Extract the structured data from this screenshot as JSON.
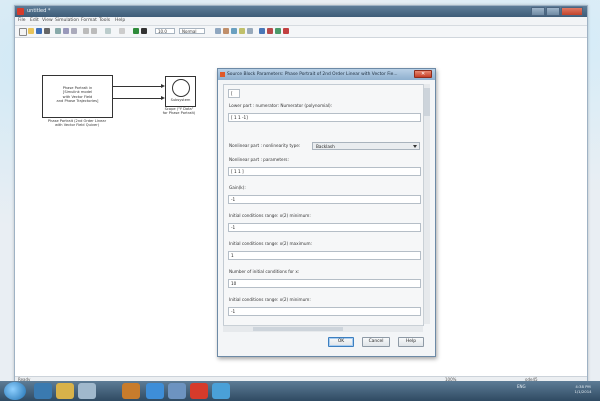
{
  "window": {
    "title": "untitled *",
    "menu": [
      "File",
      "Edit",
      "View",
      "Simulation",
      "Format",
      "Tools",
      "Help"
    ],
    "toolbar": {
      "stop_time": "10.0",
      "mode": "Normal"
    },
    "status": {
      "left": "Ready",
      "mid": "100%",
      "right": "ode45"
    }
  },
  "model": {
    "block1": {
      "lines": [
        "Phase Portrait in",
        "[Simulink model",
        "with Vector Field",
        "and Phase Trajectories]"
      ]
    },
    "block1_label": [
      "Phase Portrait (2nd Order Linear",
      "with Vector Field Quiver)"
    ],
    "block2": {
      "label": "Subsystem"
    },
    "block2_label": [
      "Scope (\"Y Data\"",
      "for Phase Portrait)"
    ]
  },
  "dialog": {
    "title": "Source Block Parameters: Phase Portrait of 2nd Order Linear with Vector Fie...",
    "params": [
      {
        "label": "",
        "value": "["
      },
      {
        "label": "Lower part : numerator: Numerator (polynomial):",
        "value": "[ 1 1 -1]"
      },
      {
        "label": "Nonlinear part : nonlinearity type:",
        "value": ""
      },
      {
        "label": "Nonlinear part : parameters:",
        "value": "[ 1 1 ]"
      },
      {
        "label": "Gain(k):",
        "value": "-1"
      },
      {
        "label": "Initial conditions range: x(2) minimum:",
        "value": "-1"
      },
      {
        "label": "Initial conditions range: x(2) maximum:",
        "value": "1"
      },
      {
        "label": "Number of initial conditions for x:",
        "value": "10"
      },
      {
        "label": "Initial conditions range: x(2) minimum:",
        "value": "-1"
      }
    ],
    "select": {
      "value": "Backlash"
    },
    "buttons": {
      "ok": "OK",
      "cancel": "Cancel",
      "help": "Help"
    }
  },
  "taskbar": {
    "tray": "ENG",
    "time": "4:38 PM",
    "date": "1/1/2014"
  }
}
